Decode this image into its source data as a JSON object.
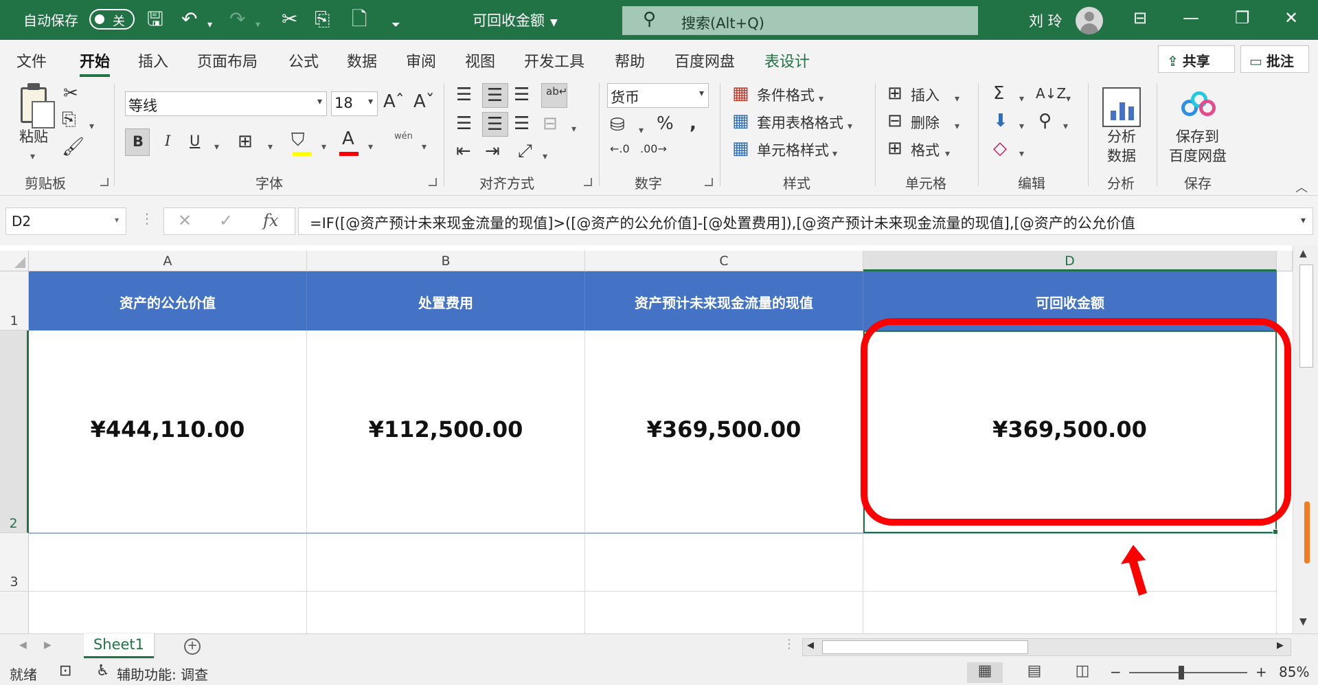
{
  "titlebar": {
    "autosave_label": "自动保存",
    "autosave_state": "关",
    "document_title": "可回收金额",
    "search_text": "搜索(Alt+Q)",
    "user_name": "刘 玲"
  },
  "menu": {
    "tabs": [
      "文件",
      "开始",
      "插入",
      "页面布局",
      "公式",
      "数据",
      "审阅",
      "视图",
      "开发工具",
      "帮助",
      "百度网盘",
      "表设计"
    ],
    "active_tab": "开始",
    "share_label": "共享",
    "comments_label": "批注"
  },
  "ribbon": {
    "clipboard": {
      "paste_label": "粘贴",
      "group_label": "剪贴板"
    },
    "font": {
      "font_name": "等线",
      "font_size": "18",
      "bold": "B",
      "italic": "I",
      "underline": "U",
      "phonetic": "wén",
      "group_label": "字体"
    },
    "alignment": {
      "group_label": "对齐方式"
    },
    "number": {
      "format": "货币",
      "group_label": "数字"
    },
    "styles": {
      "conditional": "条件格式",
      "table_format": "套用表格格式",
      "cell_styles": "单元格样式",
      "group_label": "样式"
    },
    "cells": {
      "insert": "插入",
      "delete": "删除",
      "format": "格式",
      "group_label": "单元格"
    },
    "editing": {
      "group_label": "编辑"
    },
    "analysis": {
      "line1": "分析",
      "line2": "数据",
      "group_label": "分析"
    },
    "save": {
      "line1": "保存到",
      "line2": "百度网盘",
      "group_label": "保存"
    }
  },
  "formula_bar": {
    "name_box": "D2",
    "formula": "=IF([@资产预计未来现金流量的现值]>([@资产的公允价值]-[@处置费用]),[@资产预计未来现金流量的现值],[@资产的公允价值"
  },
  "sheet": {
    "columns": [
      "A",
      "B",
      "C",
      "D"
    ],
    "rows": [
      "1",
      "2",
      "3"
    ],
    "headers": [
      "资产的公允价值",
      "处置费用",
      "资产预计未来现金流量的现值",
      "可回收金额"
    ],
    "values": [
      "¥444,110.00",
      "¥112,500.00",
      "¥369,500.00",
      "¥369,500.00"
    ],
    "selected_column": "D",
    "selected_row": "2"
  },
  "tabs_bar": {
    "sheet_name": "Sheet1"
  },
  "status": {
    "ready": "就绪",
    "accessibility": "辅助功能: 调查",
    "zoom": "85%"
  },
  "colors": {
    "excel_green": "#217346",
    "table_header_blue": "#4472c4",
    "annotation_red": "#ff0000"
  }
}
